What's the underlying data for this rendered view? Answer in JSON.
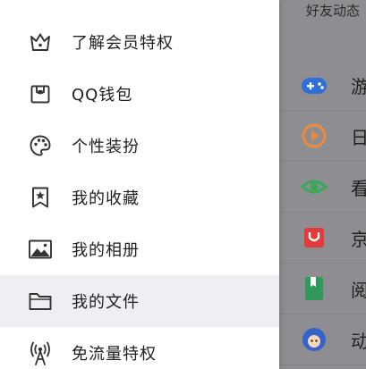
{
  "background": {
    "header_text": "好友动态",
    "rows": [
      {
        "label": "游",
        "icon": "gamepad-icon",
        "color": "#2f6fd6"
      },
      {
        "label": "日",
        "icon": "play-circle-icon",
        "color": "#f08a3a"
      },
      {
        "label": "看",
        "icon": "eye-icon",
        "color": "#3aa857"
      },
      {
        "label": "京",
        "icon": "shopping-bag-icon",
        "color": "#e23b3b"
      },
      {
        "label": "阅",
        "icon": "book-icon",
        "color": "#2e9a5c"
      },
      {
        "label": "动",
        "icon": "avatar-icon",
        "color": "#3563c9"
      }
    ]
  },
  "menu": {
    "items": [
      {
        "label": "了解会员特权",
        "icon": "crown-icon"
      },
      {
        "label": "QQ钱包",
        "icon": "wallet-icon"
      },
      {
        "label": "个性装扮",
        "icon": "palette-icon"
      },
      {
        "label": "我的收藏",
        "icon": "bookmark-star-icon"
      },
      {
        "label": "我的相册",
        "icon": "photo-icon"
      },
      {
        "label": "我的文件",
        "icon": "folder-icon",
        "active": true
      },
      {
        "label": "免流量特权",
        "icon": "signal-tower-icon"
      }
    ]
  },
  "colors": {
    "icon_stroke": "#333333",
    "drawer_bg": "#ffffff",
    "active_row_bg": "#efeef3",
    "overlay_bg": "#8e8e92"
  }
}
